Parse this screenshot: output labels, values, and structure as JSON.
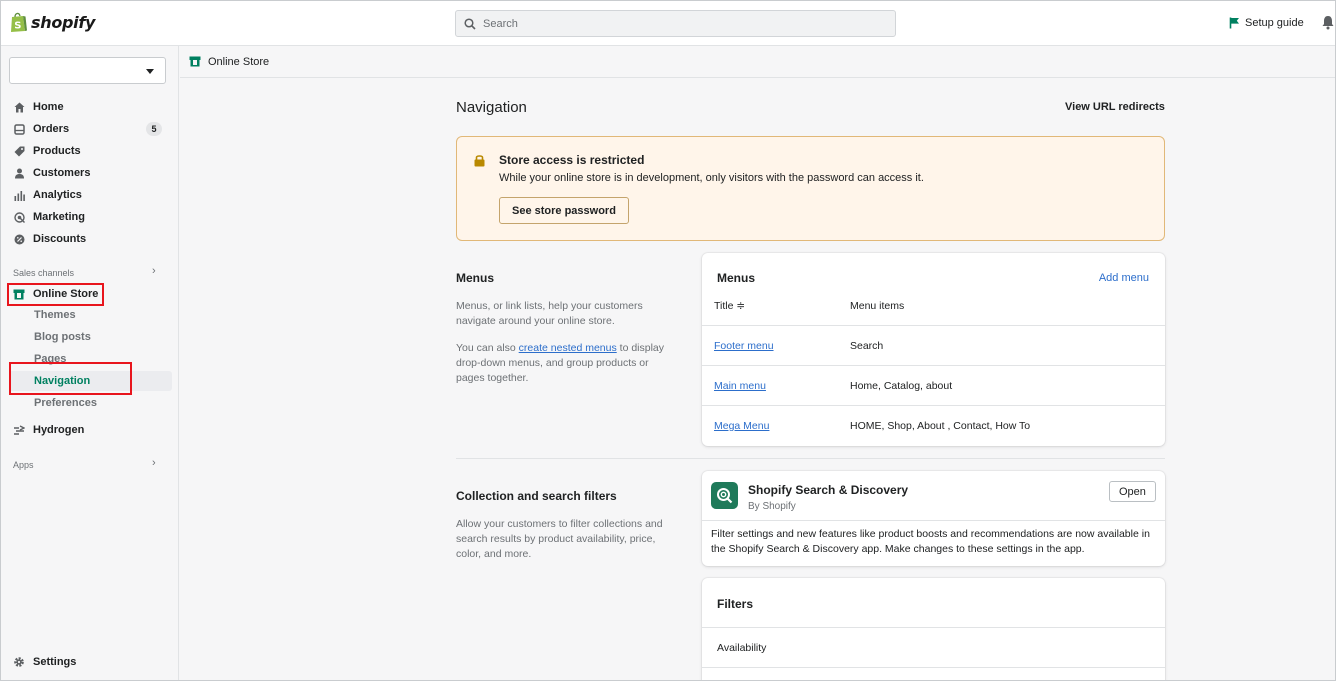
{
  "header": {
    "brand": "shopify",
    "search_placeholder": "Search",
    "setup_guide": "Setup guide"
  },
  "sidebar": {
    "store_selector_value": "",
    "items": [
      {
        "label": "Home",
        "icon": "home-icon"
      },
      {
        "label": "Orders",
        "icon": "orders-icon",
        "badge": "5"
      },
      {
        "label": "Products",
        "icon": "tag-icon"
      },
      {
        "label": "Customers",
        "icon": "person-icon"
      },
      {
        "label": "Analytics",
        "icon": "bar-chart-icon"
      },
      {
        "label": "Marketing",
        "icon": "target-icon"
      },
      {
        "label": "Discounts",
        "icon": "discount-icon"
      }
    ],
    "sales_channels_label": "Sales channels",
    "online_store": "Online Store",
    "online_store_sub": [
      "Themes",
      "Blog posts",
      "Pages",
      "Navigation",
      "Preferences"
    ],
    "hydrogen": "Hydrogen",
    "apps_label": "Apps",
    "settings": "Settings"
  },
  "breadcrumb": {
    "label": "Online Store"
  },
  "main": {
    "title": "Navigation",
    "view_url_redirects": "View URL redirects",
    "banner": {
      "title": "Store access is restricted",
      "text": "While your online store is in development, only visitors with the password can access it.",
      "button": "See store password"
    },
    "menus_section": {
      "title": "Menus",
      "desc1": "Menus, or link lists, help your customers navigate around your online store.",
      "desc2_prefix": "You can also ",
      "desc2_link": "create nested menus",
      "desc2_suffix": " to display drop-down menus, and group products or pages together."
    },
    "menus_card": {
      "title": "Menus",
      "add_menu": "Add menu",
      "col_title": "Title ≑",
      "col_items": "Menu items",
      "rows": [
        {
          "title": "Footer menu",
          "items": "Search"
        },
        {
          "title": "Main menu",
          "items": "Home, Catalog, about"
        },
        {
          "title": "Mega Menu",
          "items": "HOME, Shop, About , Contact, How To"
        }
      ]
    },
    "filters_section": {
      "title": "Collection and search filters",
      "desc": "Allow your customers to filter collections and search results by product availability, price, color, and more."
    },
    "app_card": {
      "name": "Shopify Search & Discovery",
      "by": "By Shopify",
      "open": "Open",
      "desc": "Filter settings and new features like product boosts and recommendations are now available in the Shopify Search & Discovery app. Make changes to these settings in the app."
    },
    "filters_card": {
      "title": "Filters",
      "rows": [
        "Availability"
      ]
    }
  },
  "colors": {
    "accent_green": "#008060",
    "link_blue": "#2c6ecb",
    "highlight_red": "#e8151d",
    "banner_bg": "#fff5ea"
  }
}
